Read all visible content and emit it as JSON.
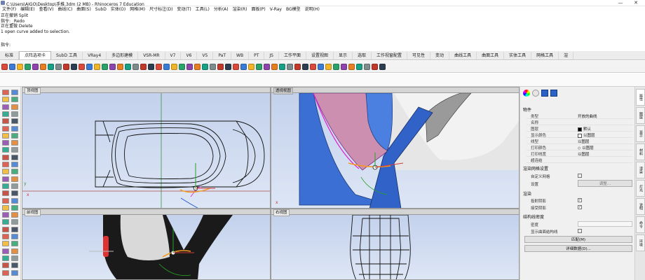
{
  "window": {
    "title": "C:\\Users\\AIGO\\Desktop\\手推.3dm (2 MB) - Rhinoceros 7 Education",
    "minimize": "—",
    "close": "✕"
  },
  "menu": [
    "文件(F)",
    "编辑(E)",
    "查看(V)",
    "曲线(C)",
    "曲面(S)",
    "SubD",
    "实体(O)",
    "网格(M)",
    "尺寸标注(D)",
    "变动(T)",
    "工具(L)",
    "分析(A)",
    "渲染(R)",
    "面板(P)",
    "V-Ray",
    "BG模型",
    "说明(H)"
  ],
  "command_history": [
    "正在撤销 Split",
    "指令: _Redo",
    "正在重做 Delete",
    "1 open curve added to selection.",
    "指令:"
  ],
  "tabs": [
    "标准",
    "点阵选项卡",
    "SubD 工具",
    "VRay4",
    "多边形建模",
    "VSR-MR",
    "V7",
    "V6",
    "V5",
    "PaT",
    "WB",
    "PT",
    "JS",
    "工作平面",
    "设置视图",
    "显示",
    "选取",
    "工作视窗配置",
    "可见性",
    "变动",
    "曲线工具",
    "曲面工具",
    "实体工具",
    "网格工具",
    "渲"
  ],
  "active_tab_index": 1,
  "viewports": {
    "top": "顶视图",
    "perspective": "透视视图",
    "front": "前视图",
    "right": "右视图"
  },
  "properties": {
    "section_object": "物件",
    "rows": [
      {
        "label": "类型",
        "value": "开放的曲线"
      },
      {
        "label": "名称",
        "value": ""
      },
      {
        "label": "图层",
        "value": "默认"
      },
      {
        "label": "显示颜色",
        "value": "以图层"
      },
      {
        "label": "线型",
        "value": "以图层"
      },
      {
        "label": "打印颜色",
        "value": "以图层"
      },
      {
        "label": "打印线宽",
        "value": "以图层"
      },
      {
        "label": "超连结",
        "value": ""
      }
    ],
    "section_render_mesh": "渲染网格设置",
    "custom_mesh_label": "自定义网格",
    "settings_label": "设置",
    "adjust_button": "调整...",
    "section_render": "渲染",
    "cast_shadows": "投射阴影",
    "receive_shadows": "接受阴影",
    "section_isocurve": "结构线密度",
    "density_label": "密度",
    "show_surface_isocurves": "显示曲面结构线",
    "match_button": "匹配(M)",
    "details_button": "详细数据(D)..."
  },
  "panel_tabs": [
    "属性",
    "图层",
    "显示",
    "材料",
    "渲染",
    "灯光",
    "说明",
    "命令",
    "环境"
  ],
  "colors": {
    "accent": "#1f4e9b",
    "magenta_curve": "#e01fd0",
    "orange_curve": "#f39a1f",
    "viewport_top": "#c3d1ec",
    "viewport_bottom": "#dde6f5"
  },
  "toolbar_icons": [
    "new",
    "open",
    "save",
    "print",
    "import",
    "cut",
    "copy",
    "paste",
    "undo",
    "redo",
    "pan",
    "rotate",
    "zoom",
    "zoom-extents",
    "zoom-window",
    "select",
    "points",
    "curve",
    "polyline",
    "circle",
    "arc",
    "rectangle",
    "ellipse",
    "surface",
    "extrude",
    "loft",
    "sweep",
    "revolve",
    "boolean",
    "fillet",
    "trim",
    "split",
    "join",
    "explode",
    "group",
    "mirror",
    "array",
    "rotate3d",
    "scale",
    "move",
    "copy3d",
    "layer",
    "properties",
    "render",
    "material",
    "light",
    "analyze",
    "dimension",
    "text",
    "snap"
  ]
}
